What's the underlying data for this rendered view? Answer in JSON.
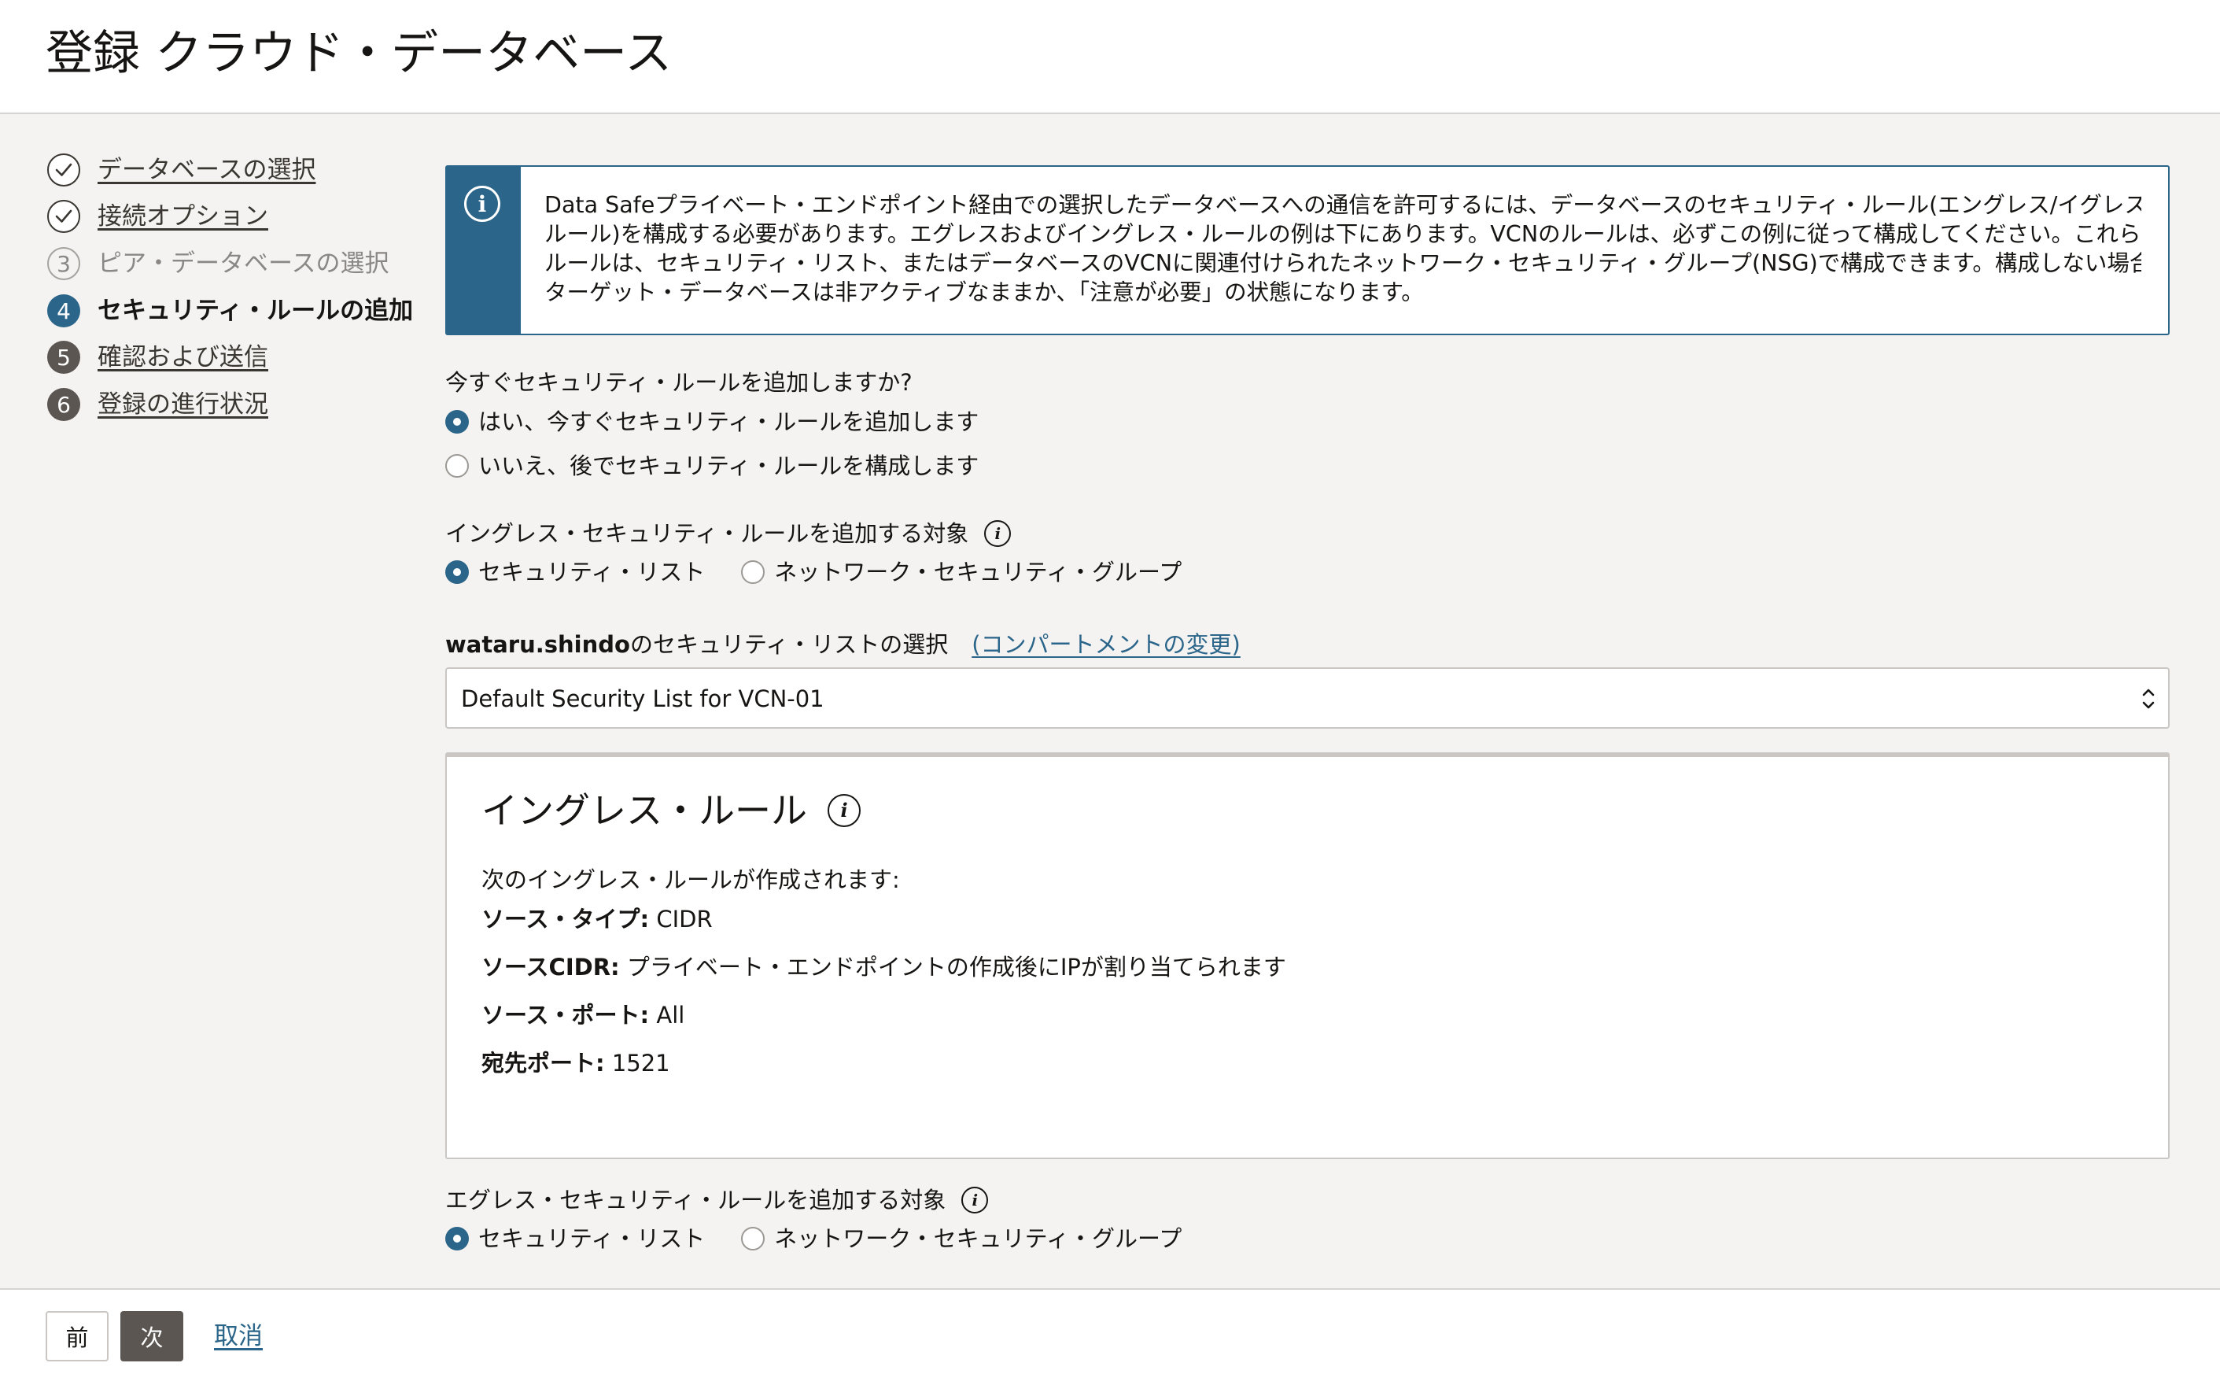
{
  "page": {
    "title": "登録 クラウド・データベース"
  },
  "steps": [
    {
      "marker": "",
      "label": "データベースの選択",
      "state": "done"
    },
    {
      "marker": "",
      "label": "接続オプション",
      "state": "done"
    },
    {
      "marker": "3",
      "label": "ピア・データベースの選択",
      "state": "disabled"
    },
    {
      "marker": "4",
      "label": "セキュリティ・ルールの追加",
      "state": "current"
    },
    {
      "marker": "5",
      "label": "確認および送信",
      "state": "todo"
    },
    {
      "marker": "6",
      "label": "登録の進行状況",
      "state": "todo"
    }
  ],
  "info": {
    "icon": "info-icon",
    "lines": [
      "Data Safeプライベート・エンドポイント経由での選択したデータベースへの通信を許可するには、データベースのセキュリティ・ルール(エングレス/イグレス・",
      "ルール)を構成する必要があります。エグレスおよびイングレス・ルールの例は下にあります。VCNのルールは、必ずこの例に従って構成してください。これらの",
      "ルールは、セキュリティ・リスト、またはデータベースのVCNに関連付けられたネットワーク・セキュリティ・グループ(NSG)で構成できます。構成しない場合、",
      "ターゲット・データベースは非アクティブなままか、「注意が必要」の状態になります。"
    ]
  },
  "add_now": {
    "question": "今すぐセキュリティ・ルールを追加しますか?",
    "options": [
      {
        "label": "はい、今すぐセキュリティ・ルールを追加します",
        "selected": true
      },
      {
        "label": "いいえ、後でセキュリティ・ルールを構成します",
        "selected": false
      }
    ]
  },
  "ingress_target": {
    "label": "イングレス・セキュリティ・ルールを追加する対象",
    "options": [
      {
        "label": "セキュリティ・リスト",
        "selected": true
      },
      {
        "label": "ネットワーク・セキュリティ・グループ",
        "selected": false
      }
    ]
  },
  "security_list": {
    "compartment": "wataru.shindo",
    "label_suffix": "のセキュリティ・リストの選択",
    "change_link": "(コンパートメントの変更)",
    "selected": "Default Security List for VCN-01"
  },
  "ingress_rule": {
    "title": "イングレス・ルール",
    "intro": "次のイングレス・ルールが作成されます:",
    "rows": [
      {
        "key": "ソース・タイプ:",
        "value": " CIDR"
      },
      {
        "key": "ソースCIDR:",
        "value": " プライベート・エンドポイントの作成後にIPが割り当てられます"
      },
      {
        "key": "ソース・ポート:",
        "value": " All"
      },
      {
        "key": "宛先ポート:",
        "value": " 1521"
      }
    ]
  },
  "egress_target": {
    "label": "エグレス・セキュリティ・ルールを追加する対象",
    "options": [
      {
        "label": "セキュリティ・リスト",
        "selected": true
      },
      {
        "label": "ネットワーク・セキュリティ・グループ",
        "selected": false
      }
    ]
  },
  "footer": {
    "prev_label": "前",
    "next_label": "次",
    "cancel_label": "取消"
  },
  "colors": {
    "accent": "#2b6589",
    "step_todo": "#5b5652",
    "background": "#f4f3f2"
  }
}
